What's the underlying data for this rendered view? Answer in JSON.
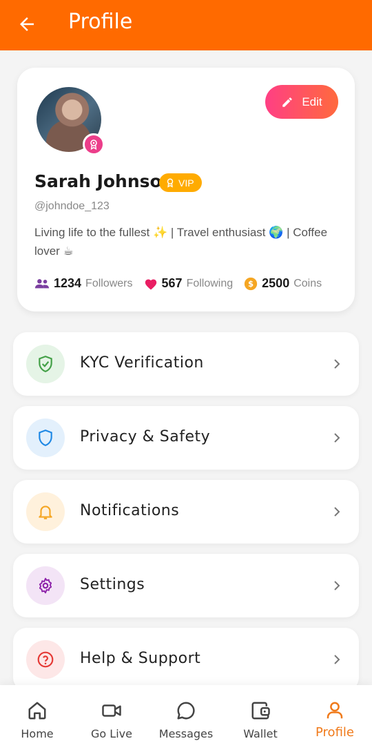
{
  "appbar": {
    "title": "Profile"
  },
  "profile": {
    "name": "Sarah Johnson",
    "vip_label": "VIP",
    "handle": "@johndoe_123",
    "bio": "Living life to the fullest ✨ | Travel enthusiast 🌍 | Coffee lover ☕",
    "edit_label": "Edit",
    "followers_count": "1234",
    "followers_label": "Followers",
    "following_count": "567",
    "following_label": "Following",
    "coins_count": "2500",
    "coins_label": "Coins"
  },
  "menu": [
    {
      "label": "KYC Verification",
      "icon": "shield-check-icon",
      "color": "#43a047",
      "bg": "#e5f4e6"
    },
    {
      "label": "Privacy & Safety",
      "icon": "shield-icon",
      "color": "#1e88e5",
      "bg": "#e3f0fc"
    },
    {
      "label": "Notifications",
      "icon": "bell-icon",
      "color": "#f5a623",
      "bg": "#fff1dc"
    },
    {
      "label": "Settings",
      "icon": "gear-icon",
      "color": "#8e24aa",
      "bg": "#f3e4f6"
    },
    {
      "label": "Help & Support",
      "icon": "help-icon",
      "color": "#e53935",
      "bg": "#fde7e7"
    }
  ],
  "nav": [
    {
      "label": "Home",
      "icon": "home-icon"
    },
    {
      "label": "Go Live",
      "icon": "video-camera-icon"
    },
    {
      "label": "Messages",
      "icon": "chat-bubble-icon"
    },
    {
      "label": "Wallet",
      "icon": "wallet-icon"
    },
    {
      "label": "Profile",
      "icon": "user-icon",
      "active": true
    }
  ],
  "colors": {
    "accent": "#ff6a00",
    "vip": "#ffab00",
    "heart": "#e91e63",
    "coin": "#f5a623",
    "followers_icon": "#7b3fa0"
  }
}
